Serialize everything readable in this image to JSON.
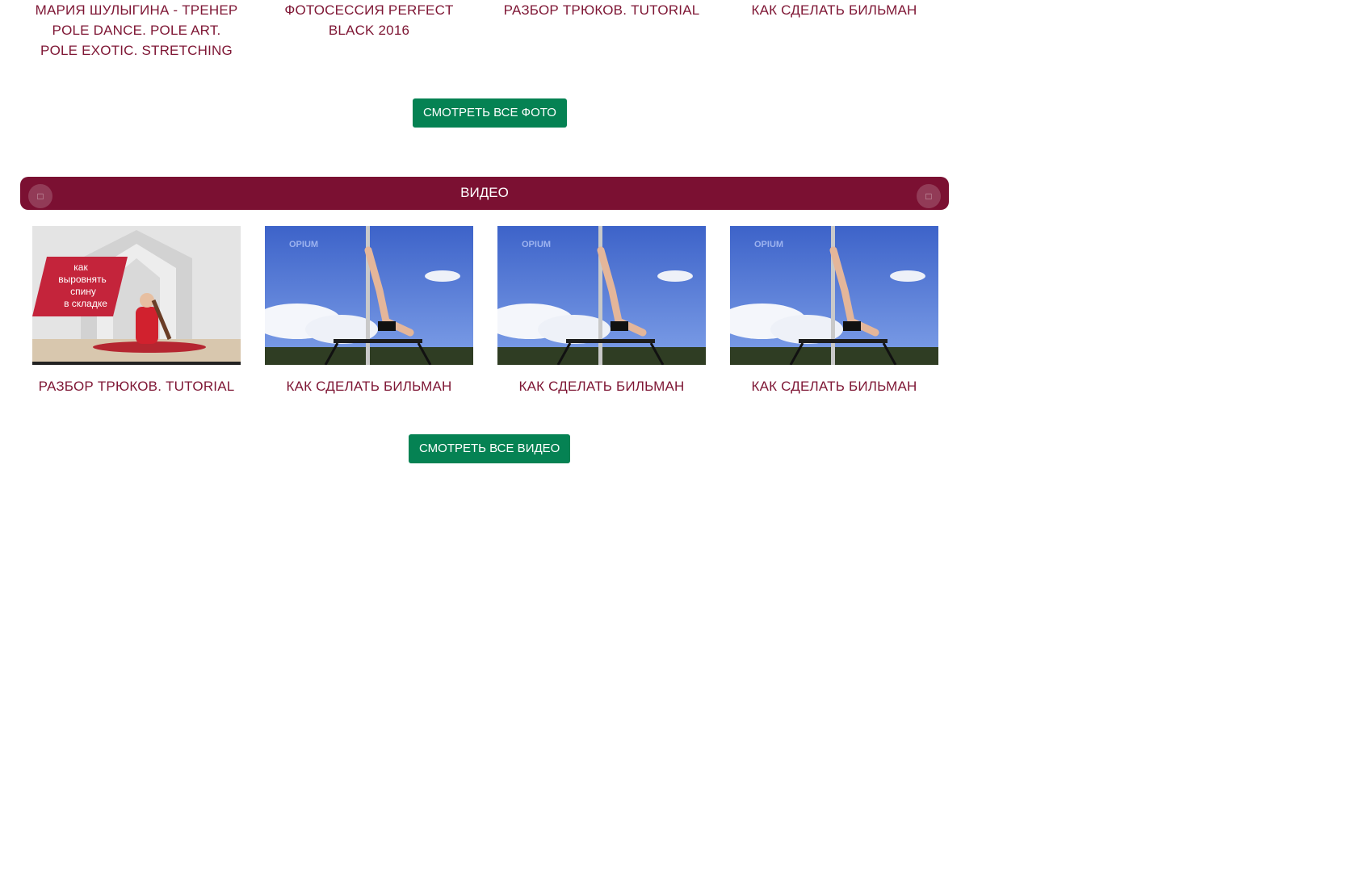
{
  "photos": {
    "items": [
      {
        "title": "Мария Шулыгина - тренер Pole Dance. Pole Art. Pole Exotic. Stretching"
      },
      {
        "title": "Фотосессия Perfect Black 2016"
      },
      {
        "title": "Разбор трюков. Tutorial"
      },
      {
        "title": "Как сделать бильман"
      }
    ],
    "view_all_label": "Смотреть все фото"
  },
  "videos": {
    "section_title": "Видео",
    "prev_icon": "chevron-left-icon",
    "next_icon": "chevron-right-icon",
    "items": [
      {
        "title": "Разбор трюков. Tutorial",
        "thumb_text": "как выровнять спину в складке"
      },
      {
        "title": "Как сделать бильман",
        "thumb_text": "OPIUM"
      },
      {
        "title": "Как сделать бильман",
        "thumb_text": "OPIUM"
      },
      {
        "title": "Как сделать бильман",
        "thumb_text": "OPIUM"
      }
    ],
    "view_all_label": "Смотреть все видео"
  },
  "colors": {
    "brand": "#7b1032",
    "button": "#058253",
    "caption": "#7e1634"
  }
}
